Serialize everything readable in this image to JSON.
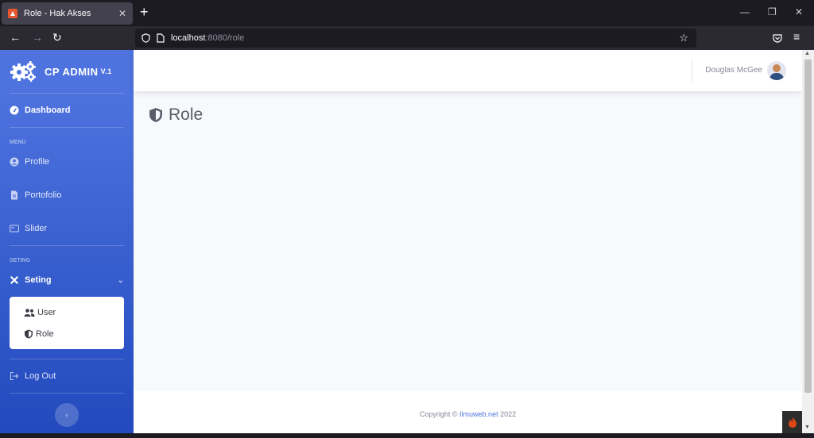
{
  "browser": {
    "tab_title": "Role - Hak Akses",
    "tab_close": "✕",
    "new_tab": "+",
    "url_host": "localhost",
    "url_path": ":8080/role"
  },
  "sidebar": {
    "brand": "CP ADMIN",
    "brand_version": "V.1",
    "dashboard": "Dashboard",
    "menu_heading": "MENU",
    "profile": "Profile",
    "portofolio": "Portofolio",
    "slider": "Slider",
    "seting_heading": "SETING",
    "seting": "Seting",
    "sub_user": "User",
    "sub_role": "Role",
    "logout": "Log Out"
  },
  "topbar": {
    "username": "Douglas McGee"
  },
  "main": {
    "title": "Role"
  },
  "footer": {
    "prefix": "Copyright © ",
    "link": "Ilmuweb.net",
    "suffix": " 2022"
  },
  "colors": {
    "sidebar_top": "#4e73df",
    "sidebar_bottom": "#224abe",
    "page_bg": "#f8f9fc"
  }
}
